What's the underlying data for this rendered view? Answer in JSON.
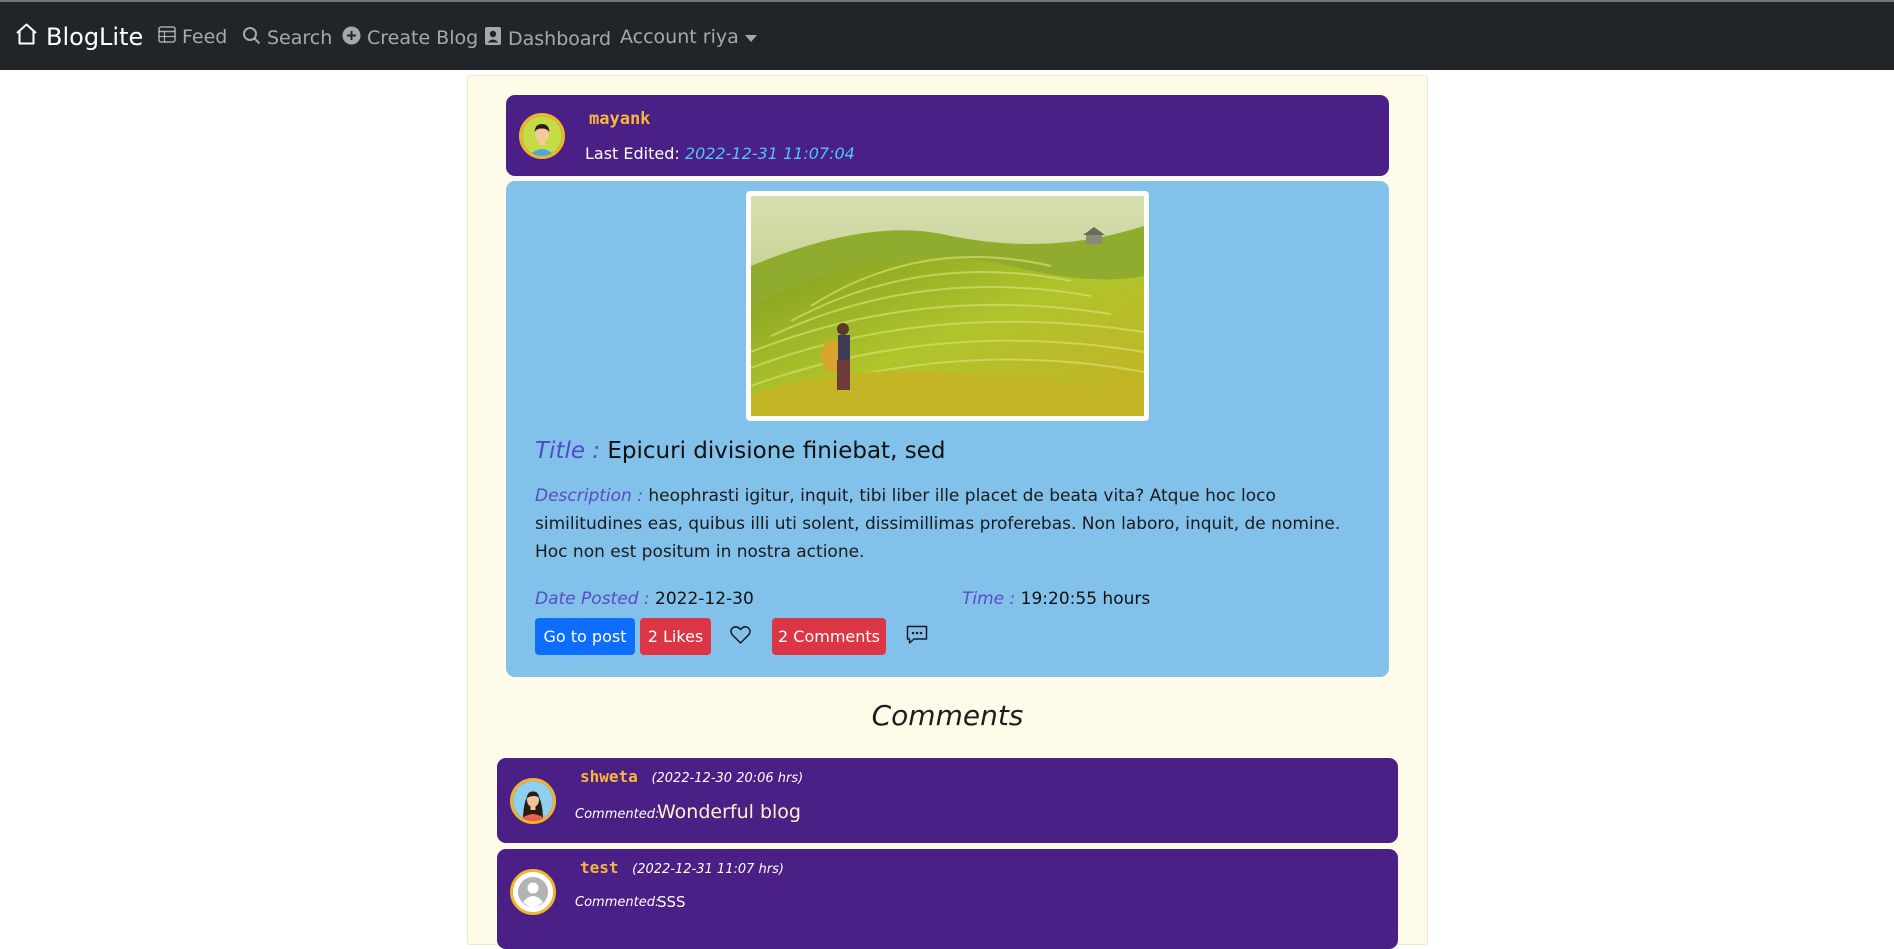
{
  "nav": {
    "brand": "BlogLite",
    "feed": "Feed",
    "search": "Search",
    "create": "Create Blog",
    "dashboard": "Dashboard",
    "account": "Account riya"
  },
  "post": {
    "author": "mayank",
    "last_edited_label": "Last Edited:",
    "last_edited": "2022-12-31 11:07:04",
    "title_label": "Title :",
    "title": "Epicuri divisione finiebat, sed",
    "description_label": "Description :",
    "description": "heophrasti igitur, inquit, tibi liber ille placet de beata vita? Atque hoc loco similitudines eas, quibus illi uti solent, dissimillimas proferebas. Non laboro, inquit, de nomine. Hoc non est positum in nostra actione.",
    "date_label": "Date Posted :",
    "date": "2022-12-30",
    "time_label": "Time :",
    "time": "19:20:55 hours",
    "go_button": "Go to post",
    "likes_button": "2 Likes",
    "comments_button": "2 Comments"
  },
  "comments": {
    "heading": "Comments",
    "label": "Commented:",
    "items": [
      {
        "user": "shweta",
        "time": "(2022-12-30 20:06 hrs)",
        "text": "Wonderful blog"
      },
      {
        "user": "test",
        "time": "(2022-12-31 11:07 hrs)",
        "text": "SSS"
      }
    ]
  },
  "colors": {
    "navbar": "#212529",
    "card_purple": "#4a1f86",
    "post_blue": "#82c1ea",
    "container_bg": "#fefce8",
    "username": "#f7b73b",
    "primary": "#0d6efd",
    "danger": "#dc3545"
  },
  "icons": {
    "brand": "house-icon",
    "feed": "table-icon",
    "search": "search-icon",
    "create": "plus-circle-icon",
    "dashboard": "person-badge-icon",
    "like": "heart-icon",
    "comment": "chat-dots-icon"
  }
}
